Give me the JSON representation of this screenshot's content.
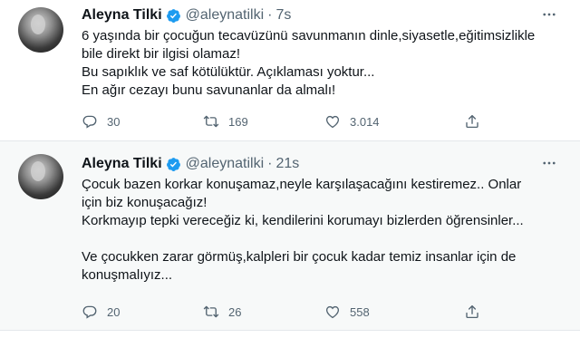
{
  "tweets": [
    {
      "author_name": "Aleyna Tilki",
      "handle": "@aleynatilki",
      "separator": "·",
      "time": "7s",
      "lines": [
        "6 yaşında bir çocuğun tecavüzünü savunmanın dinle,siyasetle,eğitimsizlikle",
        "bile direkt bir ilgisi olamaz!",
        "Bu sapıklık ve saf kötülüktür. Açıklaması yoktur...",
        "En ağır cezayı bunu savunanlar da almalı!"
      ],
      "replies": "30",
      "retweets": "169",
      "likes": "3.014"
    },
    {
      "author_name": "Aleyna Tilki",
      "handle": "@aleynatilki",
      "separator": "·",
      "time": "21s",
      "lines": [
        "Çocuk bazen korkar konuşamaz,neyle karşılaşacağını kestiremez.. Onlar",
        "için biz konuşacağız!",
        "Korkmayıp tepki vereceğiz ki, kendilerini korumayı bizlerden öğrensinler...",
        "",
        "Ve çocukken zarar görmüş,kalpleri bir çocuk kadar temiz insanlar için de",
        "konuşmalıyız..."
      ],
      "replies": "20",
      "retweets": "26",
      "likes": "558"
    }
  ],
  "icons": {
    "verified": "verified-badge-icon",
    "more": "more-options-icon",
    "reply": "reply-icon",
    "retweet": "retweet-icon",
    "like": "like-heart-icon",
    "share": "share-icon"
  },
  "colors": {
    "accent": "#1d9bf0",
    "text_primary": "#0f1419",
    "text_secondary": "#536471",
    "highlight_bg": "#f7f9f9"
  }
}
